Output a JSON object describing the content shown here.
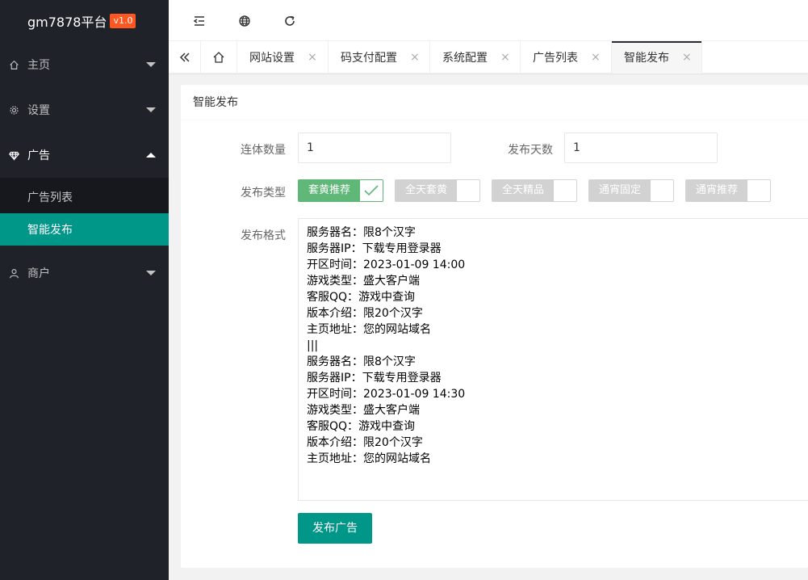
{
  "brand": {
    "name": "gm7878平台",
    "version": "v1.0"
  },
  "sidebar": {
    "items": [
      {
        "label": "主页",
        "icon": "home-icon"
      },
      {
        "label": "设置",
        "icon": "gear-icon"
      },
      {
        "label": "广告",
        "icon": "diamond-icon",
        "expanded": true,
        "children": [
          {
            "label": "广告列表"
          },
          {
            "label": "智能发布",
            "active": true
          }
        ]
      },
      {
        "label": "商户",
        "icon": "user-icon"
      }
    ]
  },
  "header": {
    "icons": [
      "menu-collapse-icon",
      "globe-icon",
      "refresh-icon"
    ]
  },
  "tabs": {
    "items": [
      {
        "label": "网站设置"
      },
      {
        "label": "码支付配置"
      },
      {
        "label": "系统配置"
      },
      {
        "label": "广告列表"
      },
      {
        "label": "智能发布",
        "active": true
      }
    ],
    "close_glyph": "×"
  },
  "page": {
    "title": "智能发布",
    "form": {
      "count_label": "连体数量",
      "count_value": "1",
      "days_label": "发布天数",
      "days_value": "1",
      "type_label": "发布类型",
      "types": [
        {
          "label": "套黄推荐",
          "on": true
        },
        {
          "label": "全天套黄",
          "on": false
        },
        {
          "label": "全天精品",
          "on": false
        },
        {
          "label": "通宵固定",
          "on": false
        },
        {
          "label": "通宵推荐",
          "on": false
        }
      ],
      "format_label": "发布格式",
      "format_value": "服务器名：限8个汉字\n服务器IP：下载专用登录器\n开区时间：2023-01-09 14:00\n游戏类型：盛大客户端\n客服QQ：游戏中查询\n版本介绍：限20个汉字\n主页地址：您的网站域名\n|||\n服务器名：限8个汉字\n服务器IP：下载专用登录器\n开区时间：2023-01-09 14:30\n游戏类型：盛大客户端\n客服QQ：游戏中查询\n版本介绍：限20个汉字\n主页地址：您的网站域名",
      "submit_label": "发布广告"
    }
  },
  "colors": {
    "sidebar": "#20222a",
    "active": "#009688",
    "switch_on": "#5fb878",
    "version_badge": "#ff5722"
  }
}
